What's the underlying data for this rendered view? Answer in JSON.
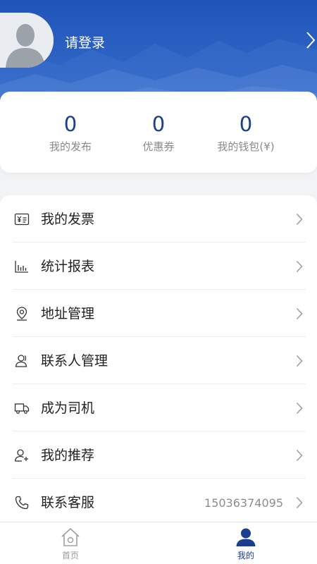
{
  "header": {
    "login_label": "请登录",
    "avatar_icon": "default-user-avatar",
    "arrow_icon": "chevron-right-icon",
    "bg_color": "#2a5fc1"
  },
  "stats": [
    {
      "value": "0",
      "label": "我的发布"
    },
    {
      "value": "0",
      "label": "优惠券"
    },
    {
      "value": "0",
      "label": "我的钱包(¥)"
    }
  ],
  "menu": [
    {
      "label": "我的发票",
      "icon": "invoice-icon",
      "value": ""
    },
    {
      "label": "统计报表",
      "icon": "bar-chart-icon",
      "value": ""
    },
    {
      "label": "地址管理",
      "icon": "location-pin-icon",
      "value": ""
    },
    {
      "label": "联系人管理",
      "icon": "contacts-icon",
      "value": ""
    },
    {
      "label": "成为司机",
      "icon": "truck-icon",
      "value": ""
    },
    {
      "label": "我的推荐",
      "icon": "add-user-icon",
      "value": ""
    },
    {
      "label": "联系客服",
      "icon": "phone-icon",
      "value": "15036374095"
    }
  ],
  "tabbar": {
    "tabs": [
      {
        "label": "首页",
        "icon": "home-icon",
        "active": false
      },
      {
        "label": "我的",
        "icon": "profile-icon",
        "active": true
      }
    ],
    "active_color": "#1a3d8f",
    "inactive_color": "#9a9a9a"
  }
}
